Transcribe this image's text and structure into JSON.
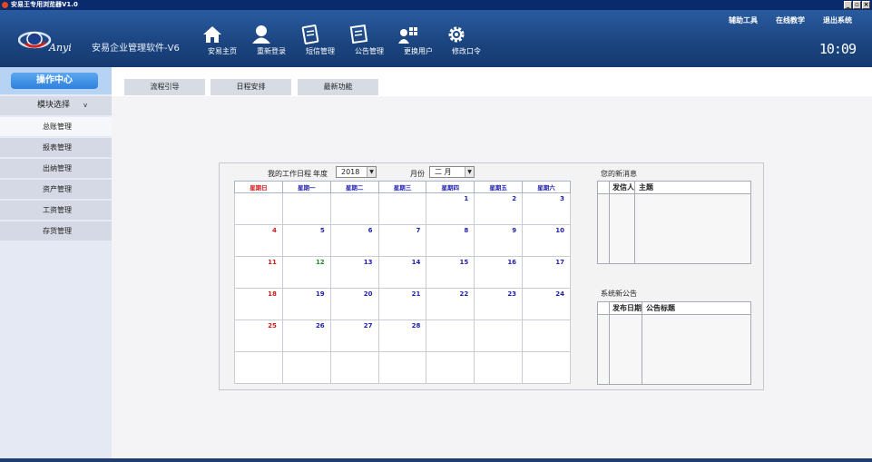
{
  "window": {
    "title": "安易王专用浏览器V1.0"
  },
  "header": {
    "product_name": "安易企业管理软件-V6",
    "logo_text": "Anyi",
    "nav": [
      {
        "label": "安易主页",
        "icon": "home-icon"
      },
      {
        "label": "重新登录",
        "icon": "user-icon"
      },
      {
        "label": "短信管理",
        "icon": "notepad-icon"
      },
      {
        "label": "公告管理",
        "icon": "notice-icon"
      },
      {
        "label": "更换用户",
        "icon": "switch-user-icon"
      },
      {
        "label": "修改口令",
        "icon": "gear-icon"
      }
    ],
    "links": {
      "tools": "辅助工具",
      "teaching": "在线教学",
      "logout": "退出系统"
    },
    "clock": "10:09"
  },
  "sidebar": {
    "op_center": "操作中心",
    "module_select": "模块选择",
    "module_select_arrow": "v",
    "items": [
      "总账管理",
      "报表管理",
      "出纳管理",
      "资产管理",
      "工资管理",
      "存货管理"
    ]
  },
  "tabs": [
    "流程引导",
    "日程安排",
    "最新功能"
  ],
  "calendar": {
    "title": "我的工作日程",
    "year_label": "年度",
    "year_value": "2018",
    "month_label": "月份",
    "month_value": "二 月",
    "weekdays": [
      "星期日",
      "星期一",
      "星期二",
      "星期三",
      "星期四",
      "星期五",
      "星期六"
    ],
    "weeks": [
      [
        "",
        "",
        "",
        "",
        "1",
        "2",
        "3"
      ],
      [
        "4",
        "5",
        "6",
        "7",
        "8",
        "9",
        "10"
      ],
      [
        "11",
        "12",
        "13",
        "14",
        "15",
        "16",
        "17"
      ],
      [
        "18",
        "19",
        "20",
        "21",
        "22",
        "23",
        "24"
      ],
      [
        "25",
        "26",
        "27",
        "28",
        "",
        "",
        ""
      ],
      [
        "",
        "",
        "",
        "",
        "",
        "",
        ""
      ]
    ],
    "colors": {
      "sunday": "#d01818",
      "weekday": "#2020b0",
      "highlight": "#1a8a2a"
    }
  },
  "messages": {
    "title": "您的新消息",
    "col_sender": "发信人",
    "col_subject": "主题"
  },
  "announcements": {
    "title": "系统新公告",
    "col_date": "发布日期",
    "col_title": "公告标题"
  }
}
